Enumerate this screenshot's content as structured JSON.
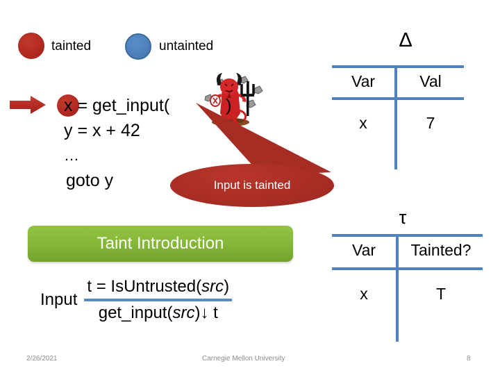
{
  "legend": {
    "tainted": {
      "label": "tainted",
      "color": "#b32b22",
      "icon": "red-circle-icon"
    },
    "untainted": {
      "label": "untainted",
      "color": "#4f81bd",
      "icon": "blue-circle-icon"
    }
  },
  "code": {
    "pointer_icon": "red-arrow-icon",
    "lines": [
      {
        "text": "x = get_input(",
        "highlighted_var": "x",
        "trailing": ")"
      },
      {
        "text": "y =  x  +  42"
      },
      {
        "text": "…"
      },
      {
        "text": "goto  y"
      }
    ],
    "line1_var": "x",
    "line1_call": "= get_input(",
    "line1_close": ")",
    "line2": "y =  x  +  42",
    "line3": "…",
    "line4": "goto  y"
  },
  "devil": {
    "icon": "devil-clipart-icon"
  },
  "callout": {
    "text": "Input is tainted",
    "color": "#a62d24"
  },
  "taint_intro": {
    "label": "Taint Introduction",
    "color": "#86b93a"
  },
  "rule": {
    "name": "Input",
    "premise": "t = IsUntrusted(src)",
    "premise_plain": "t = IsUntrusted(",
    "premise_italic": "src",
    "premise_close": ")",
    "conclusion": "get_input(src)↓ t",
    "conclusion_plain": "get_input(",
    "conclusion_italic": "src",
    "conclusion_close": ")↓ t",
    "bar_color": "#5b8bc0"
  },
  "delta_table": {
    "title": "Δ",
    "headers": [
      "Var",
      "Val"
    ],
    "rows": [
      [
        "x",
        "7"
      ]
    ],
    "line_color": "#4f81bd"
  },
  "tau_table": {
    "title": "τ",
    "headers": [
      "Var",
      "Tainted?"
    ],
    "rows": [
      [
        "x",
        "T"
      ]
    ],
    "line_color": "#4f81bd"
  },
  "footer": {
    "date": "2/26/2021",
    "organization": "Carnegie Mellon University",
    "page": "8"
  }
}
